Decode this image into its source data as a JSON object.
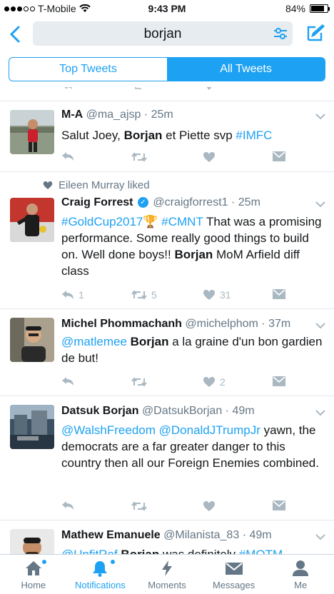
{
  "status_bar": {
    "carrier": "T-Mobile",
    "time": "9:43 PM",
    "battery": "84%",
    "battery_level": 0.84
  },
  "search": {
    "query": "borjan"
  },
  "tabs": [
    {
      "label": "Top Tweets",
      "active": false
    },
    {
      "label": "All Tweets",
      "active": true
    }
  ],
  "tweets": [
    {
      "name": "M-A",
      "handle": "@ma_ajsp",
      "time": "· 25m",
      "text_parts": [
        "Salut Joey, ",
        "Borjan",
        " et Piette svp ",
        "#IMFC"
      ],
      "reply_count": "",
      "retweet_count": "",
      "like_count": ""
    },
    {
      "social_context": "Eileen Murray liked",
      "name": "Craig Forrest",
      "handle": "@craigforrest1",
      "time": "· 25m",
      "text_parts": [
        "#GoldCup2017",
        "🏆",
        " ",
        "#CMNT",
        " That was a promising performance. Some really good things to build on. Well done boys!! ",
        "Borjan",
        " MoM Arfield diff class"
      ],
      "reply_count": "1",
      "retweet_count": "5",
      "like_count": "31"
    },
    {
      "name": "Michel Phommachanh",
      "handle": "@michelphom",
      "time": "· 37m",
      "text_parts": [
        "@matlemee",
        " ",
        "Borjan",
        " a la graine d'un bon gardien de but!"
      ],
      "reply_count": "",
      "retweet_count": "",
      "like_count": "2"
    },
    {
      "name": "Datsuk Borjan",
      "handle": "@DatsukBorjan",
      "time": "· 49m",
      "text_parts": [
        "@WalshFreedom",
        " ",
        "@DonaldJTrumpJr",
        " yawn, the democrats are a far greater danger to this country then all our Foreign Enemies combined."
      ],
      "reply_count": "",
      "retweet_count": "",
      "like_count": ""
    },
    {
      "name": "Mathew Emanuele",
      "handle": "@Milanista_83",
      "time": "· 49m",
      "text_parts": [
        "@UnfitRef",
        " ",
        "Borjan",
        " was definitely ",
        "#MOTM"
      ]
    }
  ],
  "bottom_nav": [
    {
      "label": "Home",
      "icon": "home-icon",
      "active": false,
      "dot": true
    },
    {
      "label": "Notifications",
      "icon": "bell-icon",
      "active": true,
      "dot": true
    },
    {
      "label": "Moments",
      "icon": "lightning-icon",
      "active": false,
      "dot": false
    },
    {
      "label": "Messages",
      "icon": "envelope-icon",
      "active": false,
      "dot": false
    },
    {
      "label": "Me",
      "icon": "person-icon",
      "active": false,
      "dot": false
    }
  ],
  "colors": {
    "accent": "#1da1f2",
    "muted": "#657786",
    "action": "#aab8c2"
  }
}
